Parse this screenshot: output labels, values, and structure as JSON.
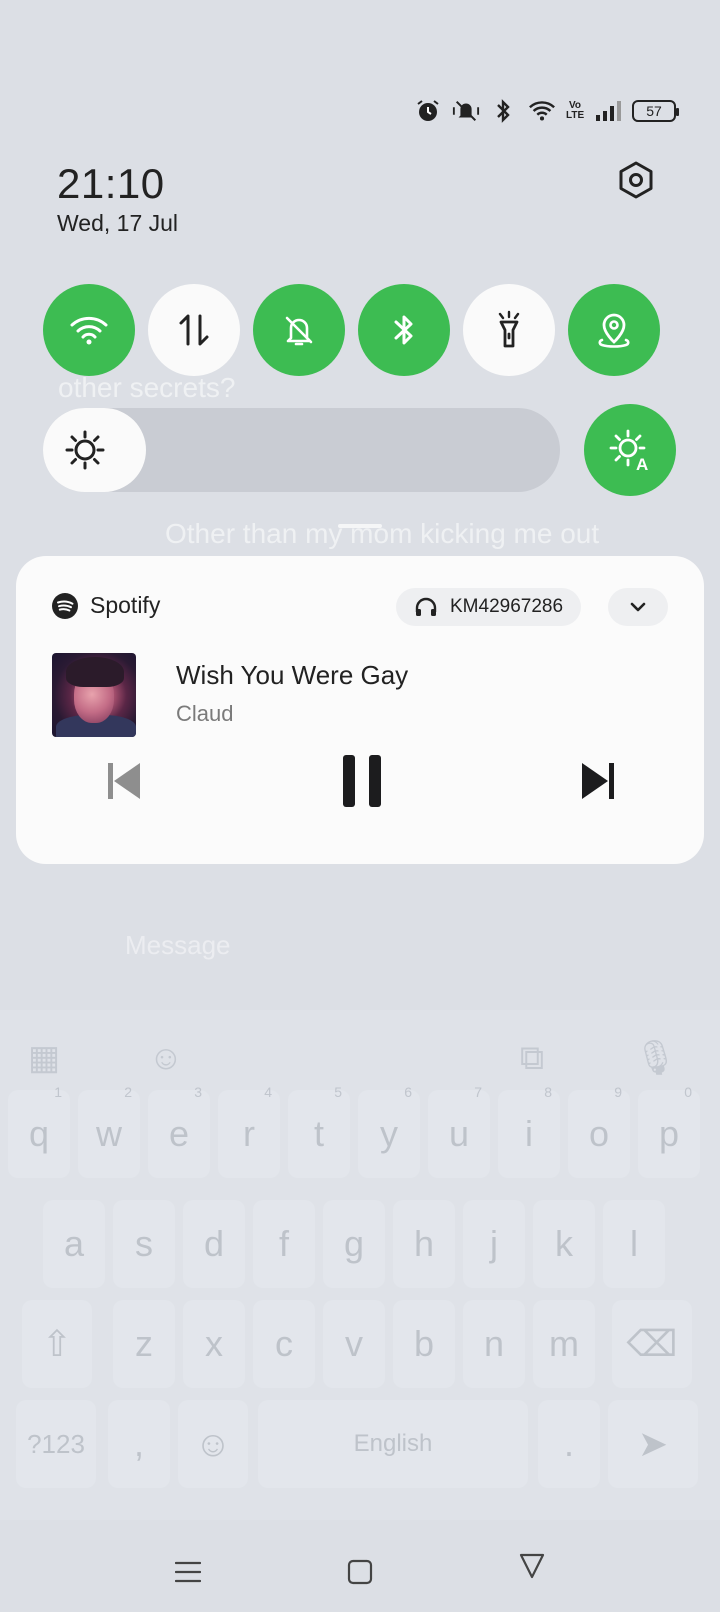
{
  "status_bar": {
    "battery_level": "57",
    "icons": [
      "alarm-icon",
      "vibrate-mute-icon",
      "bluetooth-icon",
      "wifi-icon",
      "volte-icon",
      "signal-icon",
      "battery-icon"
    ],
    "volte_label": "Vo LTE"
  },
  "header": {
    "time": "21:10",
    "date": "Wed, 17 Jul"
  },
  "quick_tiles": [
    {
      "name": "wifi",
      "icon": "wifi-icon",
      "state": "on"
    },
    {
      "name": "mobile-data",
      "icon": "data-transfer-icon",
      "state": "off"
    },
    {
      "name": "mute",
      "icon": "bell-off-icon",
      "state": "on"
    },
    {
      "name": "bluetooth",
      "icon": "bluetooth-icon",
      "state": "on"
    },
    {
      "name": "flashlight",
      "icon": "flashlight-icon",
      "state": "off"
    },
    {
      "name": "location",
      "icon": "location-icon",
      "state": "on"
    }
  ],
  "brightness": {
    "level": 0.2,
    "auto_icon": "auto-brightness-icon"
  },
  "colors": {
    "tile_on": "#3dbc52",
    "tile_off": "#fafafa",
    "card_bg": "#fbfbfb"
  },
  "media": {
    "app_name": "Spotify",
    "device": "KM42967286",
    "track_title": "Wish You Were Gay",
    "artist": "Claud"
  },
  "background_app": {
    "line1": "other secrets?",
    "line2": "Other than my mom kicking me out",
    "message_placeholder": "Message",
    "keyboard_rows": [
      [
        "q",
        "w",
        "e",
        "r",
        "t",
        "y",
        "u",
        "i",
        "o",
        "p"
      ],
      [
        "a",
        "s",
        "d",
        "f",
        "g",
        "h",
        "j",
        "k",
        "l"
      ],
      [
        "z",
        "x",
        "c",
        "v",
        "b",
        "n",
        "m"
      ]
    ],
    "keyboard_numbers": [
      "1",
      "2",
      "3",
      "4",
      "5",
      "6",
      "7",
      "8",
      "9",
      "0"
    ],
    "symbols_key": "?123",
    "comma_key": ",",
    "space_label": "English",
    "period_key": "."
  }
}
